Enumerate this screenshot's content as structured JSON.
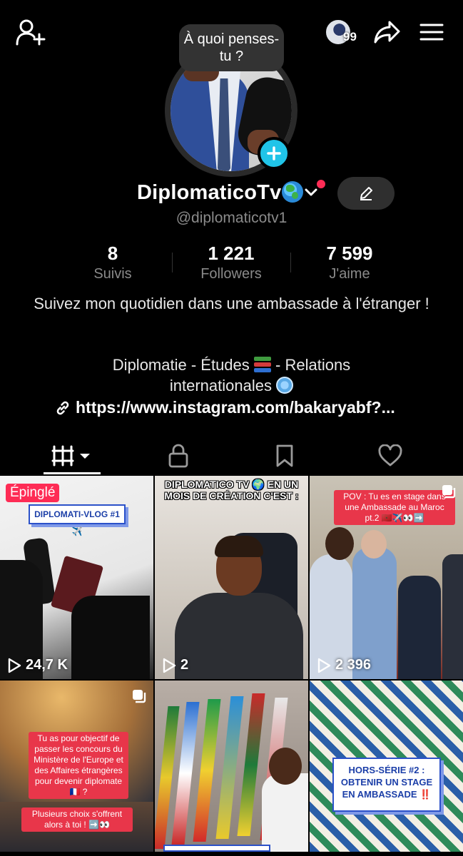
{
  "header": {
    "notification_count": "99"
  },
  "profile": {
    "bubble_text": "À quoi penses-tu ?",
    "display_name": "DiplomaticoTv",
    "username": "@diplomaticotv1"
  },
  "stats": [
    {
      "value": "8",
      "label": "Suivis"
    },
    {
      "value": "1 221",
      "label": "Followers"
    },
    {
      "value": "7 599",
      "label": "J'aime"
    }
  ],
  "bio": {
    "line1": "Suivez mon quotidien dans une ambassade à l'étranger !",
    "line2_a": "Diplomatie - Études",
    "line2_b": "- Relations",
    "line3": "internationales",
    "link": "https://www.instagram.com/bakaryabf?..."
  },
  "videos": [
    {
      "views": "24,7 K",
      "pinned_label": "Épinglé",
      "caption": "DIPLOMATI-VLOG #1✈️"
    },
    {
      "views": "2",
      "caption": "DIPLOMATICO TV 🌍 EN UN MOIS DE CRÉATION C'EST :"
    },
    {
      "views": "2 396",
      "caption": "POV : Tu es en stage dans une Ambassade au Maroc pt.2 🇲🇦✈️👀➡️"
    },
    {
      "caption_a": "Tu as pour objectif de passer les concours du Ministère de l'Europe et des Affaires étrangères pour devenir diplomate 🇫🇷 ?",
      "caption_b": "Plusieurs choix s'offrent alors à toi ! ➡️👀"
    },
    {
      "caption": ""
    },
    {
      "caption": "HORS-SÉRIE #2 : OBTENIR UN STAGE EN AMBASSADE ‼️"
    }
  ],
  "colors": {
    "accent_cyan": "#20c4e8",
    "accent_red": "#fe2c55",
    "background": "#000000"
  }
}
